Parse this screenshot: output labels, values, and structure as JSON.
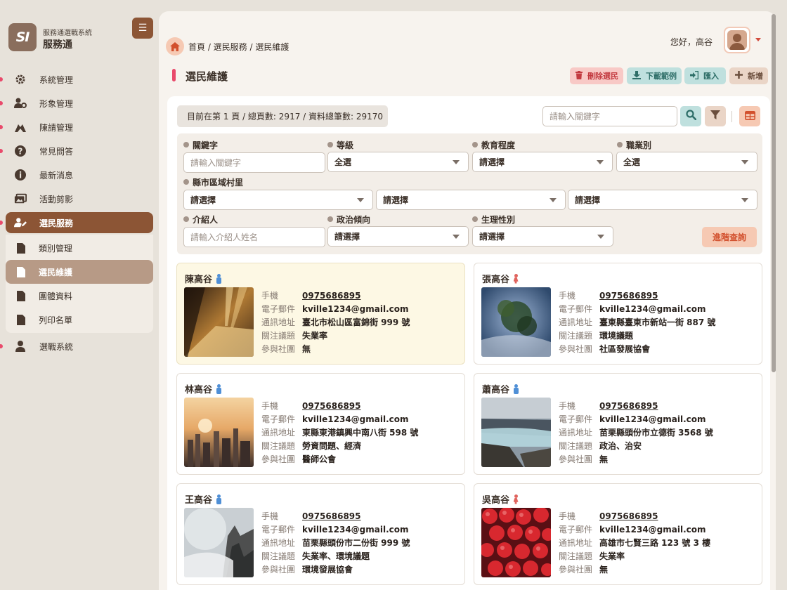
{
  "brand": {
    "logo_text": "SI",
    "subtitle": "服務通選戰系統",
    "name": "服務通"
  },
  "sidebar": {
    "items": [
      {
        "label": "系統管理",
        "icon": "gear-icon"
      },
      {
        "label": "形象管理",
        "icon": "user-cog-icon"
      },
      {
        "label": "陳請管理",
        "icon": "hands-icon"
      },
      {
        "label": "常見問答",
        "icon": "question-circle-icon"
      },
      {
        "label": "最新消息",
        "icon": "info-circle-icon"
      },
      {
        "label": "活動剪影",
        "icon": "images-icon"
      },
      {
        "label": "選民服務",
        "icon": "user-edit-icon",
        "active": true
      },
      {
        "label": "選戰系統",
        "icon": "user-icon"
      }
    ],
    "subitems": [
      {
        "label": "類別管理"
      },
      {
        "label": "選民維護",
        "active": true
      },
      {
        "label": "團體資料"
      },
      {
        "label": "列印名單"
      }
    ]
  },
  "header": {
    "breadcrumb": "首頁 / 選民服務 / 選民維護",
    "greeting": "您好，高谷",
    "page_title": "選民維護"
  },
  "actions": {
    "delete": "刪除選民",
    "download": "下載範例",
    "import": "匯入",
    "add": "新增"
  },
  "toolbar": {
    "page_info": "目前在第 1 頁 / 總頁數: 2917 / 資料總筆數: 29170",
    "search_placeholder": "請輸入關鍵字"
  },
  "filters": {
    "keyword": {
      "label": "關鍵字",
      "placeholder": "請輸入關鍵字"
    },
    "level": {
      "label": "等級",
      "value": "全選"
    },
    "education": {
      "label": "教育程度",
      "value": "請選擇"
    },
    "occupation": {
      "label": "職業別",
      "value": "全選"
    },
    "region": {
      "label": "縣市區域村里",
      "values": [
        "請選擇",
        "請選擇",
        "請選擇"
      ]
    },
    "referrer": {
      "label": "介紹人",
      "placeholder": "請輸入介紹人姓名"
    },
    "politics": {
      "label": "政治傾向",
      "value": "請選擇"
    },
    "sex": {
      "label": "生理性別",
      "value": "請選擇"
    },
    "advanced_button": "進階查詢"
  },
  "field_labels": {
    "phone": "手機",
    "email": "電子郵件",
    "address": "通訊地址",
    "issues": "關注議題",
    "groups": "參與社團"
  },
  "voters": [
    {
      "name": "陳高谷",
      "gender": "male",
      "phone": "0975686895",
      "email": "kville1234@gmail.com",
      "address": "臺北市松山區富錦街 999 號",
      "issues": "失業率",
      "groups": "無",
      "photo": "hallway-photo",
      "highlight": true
    },
    {
      "name": "張高谷",
      "gender": "female",
      "phone": "0975686895",
      "email": "kville1234@gmail.com",
      "address": "臺東縣臺東市新站一街 887 號",
      "issues": "環境議題",
      "groups": "社區發展協會",
      "photo": "tree-reflection-photo"
    },
    {
      "name": "林高谷",
      "gender": "male",
      "phone": "0975686895",
      "email": "kville1234@gmail.com",
      "address": "東縣東港鎮興中南八街 598 號",
      "issues": "勞資問題、經濟",
      "groups": "醫師公會",
      "photo": "city-sunset-photo"
    },
    {
      "name": "蕭高谷",
      "gender": "male",
      "phone": "0975686895",
      "email": "kville1234@gmail.com",
      "address": "苗栗縣頭份市立德街 3568 號",
      "issues": "政治、治安",
      "groups": "無",
      "photo": "waterfall-photo"
    },
    {
      "name": "王高谷",
      "gender": "male",
      "phone": "0975686895",
      "email": "kville1234@gmail.com",
      "address": "苗栗縣頭份市二份街 999 號",
      "issues": "失業率、環境議題",
      "groups": "環境發展協會",
      "photo": "misty-mountain-photo"
    },
    {
      "name": "吳高谷",
      "gender": "female",
      "phone": "0975686895",
      "email": "kville1234@gmail.com",
      "address": "高雄市七賢三路 123 號 3 樓",
      "issues": "失業率",
      "groups": "無",
      "photo": "strawberries-photo"
    }
  ]
}
